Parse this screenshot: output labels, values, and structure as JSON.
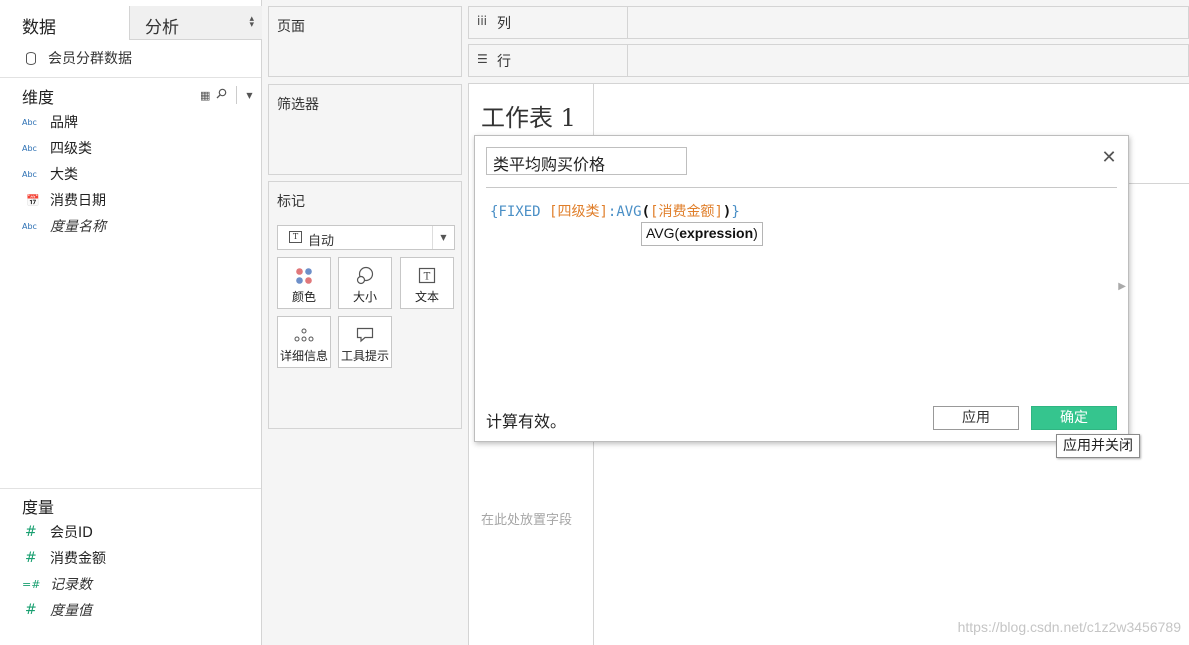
{
  "left_pane": {
    "tabs": {
      "data": "数据",
      "analysis": "分析"
    },
    "datasource": "会员分群数据",
    "dimensions": {
      "title": "维度",
      "fields": [
        {
          "icon": "Abc",
          "label": "品牌",
          "italic": false
        },
        {
          "icon": "Abc",
          "label": "四级类",
          "italic": false
        },
        {
          "icon": "Abc",
          "label": "大类",
          "italic": false
        },
        {
          "icon": "calendar-icon",
          "label": "消费日期",
          "italic": false
        },
        {
          "icon": "Abc",
          "label": "度量名称",
          "italic": true
        }
      ]
    },
    "measures": {
      "title": "度量",
      "fields": [
        {
          "icon": "#",
          "label": "会员ID",
          "italic": false
        },
        {
          "icon": "#",
          "label": "消费金额",
          "italic": false
        },
        {
          "icon": "=#",
          "label": "记录数",
          "italic": true
        },
        {
          "icon": "#",
          "label": "度量值",
          "italic": true
        }
      ]
    }
  },
  "shelves": {
    "pages": "页面",
    "filters": "筛选器",
    "marks": {
      "title": "标记",
      "type": "自动",
      "buttons": [
        "颜色",
        "大小",
        "文本",
        "详细信息",
        "工具提示"
      ]
    },
    "columns": "列",
    "rows": "行"
  },
  "sheet": {
    "title": "工作表 1",
    "drop_hint": "在此处放置字段",
    "watermark": "https://blog.csdn.net/c1z2w3456789"
  },
  "calc_dialog": {
    "name": "类平均购买价格",
    "formula": {
      "open": "{",
      "kw_fixed": "FIXED ",
      "dim": "[四级类]",
      "colon": ":",
      "fn": "AVG",
      "lparen": "(",
      "measure": "[消费金额]",
      "rparen": ")",
      "close": "}"
    },
    "hint": {
      "fn": "AVG(",
      "arg": "expression",
      "end": ")"
    },
    "status": "计算有效。",
    "apply_label": "应用",
    "ok_label": "确定",
    "ok_color": "#35c58e",
    "ok_tooltip": "应用并关闭"
  }
}
